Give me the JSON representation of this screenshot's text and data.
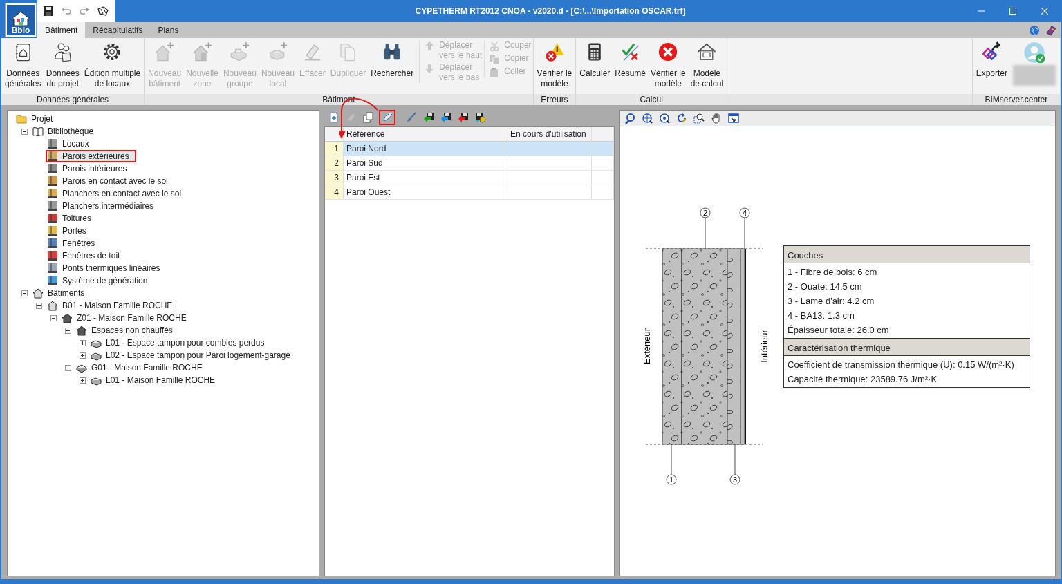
{
  "window": {
    "title": "CYPETHERM RT2012 CNOA - v2020.d - [C:\\...\\Importation OSCAR.trf]",
    "app_badge": "Bbio"
  },
  "ribbon_tabs": [
    {
      "label": "Bâtiment",
      "selected": true
    },
    {
      "label": "Récapitulatifs",
      "selected": false
    },
    {
      "label": "Plans",
      "selected": false
    }
  ],
  "ribbon_groups": [
    {
      "label": "Données générales",
      "items": [
        {
          "kind": "large",
          "lines": [
            "Données",
            "générales"
          ],
          "disabled": false
        },
        {
          "kind": "large",
          "lines": [
            "Données",
            "du projet"
          ],
          "disabled": false
        },
        {
          "kind": "large",
          "lines": [
            "Édition multiple",
            "de locaux"
          ],
          "disabled": false
        }
      ]
    },
    {
      "label": "Bâtiment",
      "items": [
        {
          "kind": "large",
          "lines": [
            "Nouveau",
            "bâtiment"
          ],
          "disabled": true
        },
        {
          "kind": "large",
          "lines": [
            "Nouvelle",
            "zone"
          ],
          "disabled": true
        },
        {
          "kind": "large",
          "lines": [
            "Nouveau",
            "groupe"
          ],
          "disabled": true
        },
        {
          "kind": "large",
          "lines": [
            "Nouveau",
            "local"
          ],
          "disabled": true
        },
        {
          "kind": "large",
          "lines": [
            "Effacer"
          ],
          "disabled": true
        },
        {
          "kind": "large",
          "lines": [
            "Dupliquer"
          ],
          "disabled": true
        },
        {
          "kind": "large",
          "lines": [
            "Rechercher"
          ],
          "disabled": false
        },
        {
          "kind": "stack",
          "items": [
            {
              "lines": [
                "Déplacer",
                "vers le haut"
              ],
              "disabled": true
            },
            {
              "lines": [
                "Déplacer",
                "vers le bas"
              ],
              "disabled": true
            }
          ]
        },
        {
          "kind": "stack",
          "items": [
            {
              "lines": [
                "Couper"
              ],
              "disabled": true
            },
            {
              "lines": [
                "Copier"
              ],
              "disabled": true
            },
            {
              "lines": [
                "Coller"
              ],
              "disabled": true
            }
          ]
        }
      ]
    },
    {
      "label": "Erreurs",
      "items": [
        {
          "kind": "large",
          "lines": [
            "Vérifier le",
            "modèle"
          ],
          "disabled": false
        }
      ]
    },
    {
      "label": "Calcul",
      "items": [
        {
          "kind": "large",
          "lines": [
            "Calculer"
          ],
          "disabled": false
        },
        {
          "kind": "large",
          "lines": [
            "Résumé"
          ],
          "disabled": false
        },
        {
          "kind": "large",
          "lines": [
            "Vérifier le",
            "modèle"
          ],
          "disabled": false
        },
        {
          "kind": "large",
          "lines": [
            "Modèle",
            "de calcul"
          ],
          "disabled": false
        }
      ]
    },
    {
      "kind": "spacer"
    },
    {
      "label": "BIMserver.center",
      "items": [
        {
          "kind": "large",
          "lines": [
            "Exporter"
          ],
          "disabled": false
        },
        {
          "kind": "account"
        }
      ]
    }
  ],
  "tree": [
    {
      "label": "Projet",
      "kind": "folder",
      "selected": false,
      "children": [
        {
          "label": "Bibliothèque",
          "kind": "library",
          "expanded": true,
          "selected": false,
          "children": [
            {
              "label": "Locaux",
              "kind": "category",
              "selected": false
            },
            {
              "label": "Parois extérieures",
              "kind": "category",
              "selected": true
            },
            {
              "label": "Parois intérieures",
              "kind": "category",
              "selected": false
            },
            {
              "label": "Parois en contact avec le sol",
              "kind": "category",
              "selected": false
            },
            {
              "label": "Planchers en contact avec le sol",
              "kind": "category",
              "selected": false
            },
            {
              "label": "Planchers intermédiaires",
              "kind": "category",
              "selected": false
            },
            {
              "label": "Toitures",
              "kind": "category",
              "selected": false
            },
            {
              "label": "Portes",
              "kind": "category",
              "selected": false
            },
            {
              "label": "Fenêtres",
              "kind": "category",
              "selected": false
            },
            {
              "label": "Fenêtres de toit",
              "kind": "category",
              "selected": false
            },
            {
              "label": "Ponts thermiques linéaires",
              "kind": "category",
              "selected": false
            },
            {
              "label": "Système de génération",
              "kind": "category",
              "selected": false
            }
          ]
        },
        {
          "label": "Bâtiments",
          "kind": "house",
          "expanded": true,
          "selected": false,
          "children": [
            {
              "label": "B01 - Maison Famille ROCHE",
              "kind": "house",
              "expanded": true,
              "selected": false,
              "children": [
                {
                  "label": "Z01 - Maison Famille ROCHE",
                  "kind": "zone",
                  "expanded": true,
                  "selected": false,
                  "children": [
                    {
                      "label": "Espaces non chauffés",
                      "kind": "zone",
                      "expanded": true,
                      "selected": false,
                      "children": [
                        {
                          "label": "L01 - Espace tampon pour combles perdus",
                          "kind": "room",
                          "expanded": false,
                          "selected": false
                        },
                        {
                          "label": "L02 - Espace tampon pour Paroi logement-garage",
                          "kind": "room",
                          "expanded": false,
                          "selected": false
                        }
                      ]
                    },
                    {
                      "label": "G01 - Maison Famille ROCHE",
                      "kind": "group",
                      "expanded": true,
                      "selected": false,
                      "children": [
                        {
                          "label": "L01 - Maison Famille ROCHE",
                          "kind": "room",
                          "expanded": false,
                          "selected": false
                        }
                      ]
                    }
                  ]
                }
              ]
            }
          ]
        }
      ]
    }
  ],
  "list_toolbar": [
    {
      "disabled": false,
      "highlighted": false
    },
    {
      "disabled": true,
      "highlighted": false
    },
    {
      "disabled": false,
      "highlighted": false
    },
    {
      "disabled": false,
      "highlighted": true
    },
    {
      "disabled": false,
      "highlighted": false
    },
    {
      "disabled": false,
      "highlighted": false
    },
    {
      "disabled": false,
      "highlighted": false
    },
    {
      "disabled": false,
      "highlighted": false
    },
    {
      "disabled": false,
      "highlighted": false
    }
  ],
  "table": {
    "columns": [
      "Référence",
      "En cours d'utilisation"
    ],
    "rows": [
      {
        "number": "1",
        "reference": "Paroi Nord",
        "selected": true
      },
      {
        "number": "2",
        "reference": "Paroi Sud",
        "selected": false
      },
      {
        "number": "3",
        "reference": "Paroi Est",
        "selected": false
      },
      {
        "number": "4",
        "reference": "Paroi Ouest",
        "selected": false
      }
    ]
  },
  "wall": {
    "exterior_label": "Extérieur",
    "interior_label": "Intérieur",
    "callouts": [
      "1",
      "2",
      "3",
      "4"
    ]
  },
  "legend": [
    {
      "title": "Couches",
      "lines": [
        "1 - Fibre de bois: 6 cm",
        "2 - Ouate: 14.5 cm",
        "3 - Lame d'air: 4.2 cm",
        "4 - BA13: 1.3 cm",
        "Épaisseur totale: 26.0 cm"
      ]
    },
    {
      "title": "Caractérisation thermique",
      "lines": [
        "Coefficient de transmission thermique (U): 0.15 W/(m²·K)",
        "Capacité thermique: 23589.76 J/m²·K"
      ]
    }
  ]
}
